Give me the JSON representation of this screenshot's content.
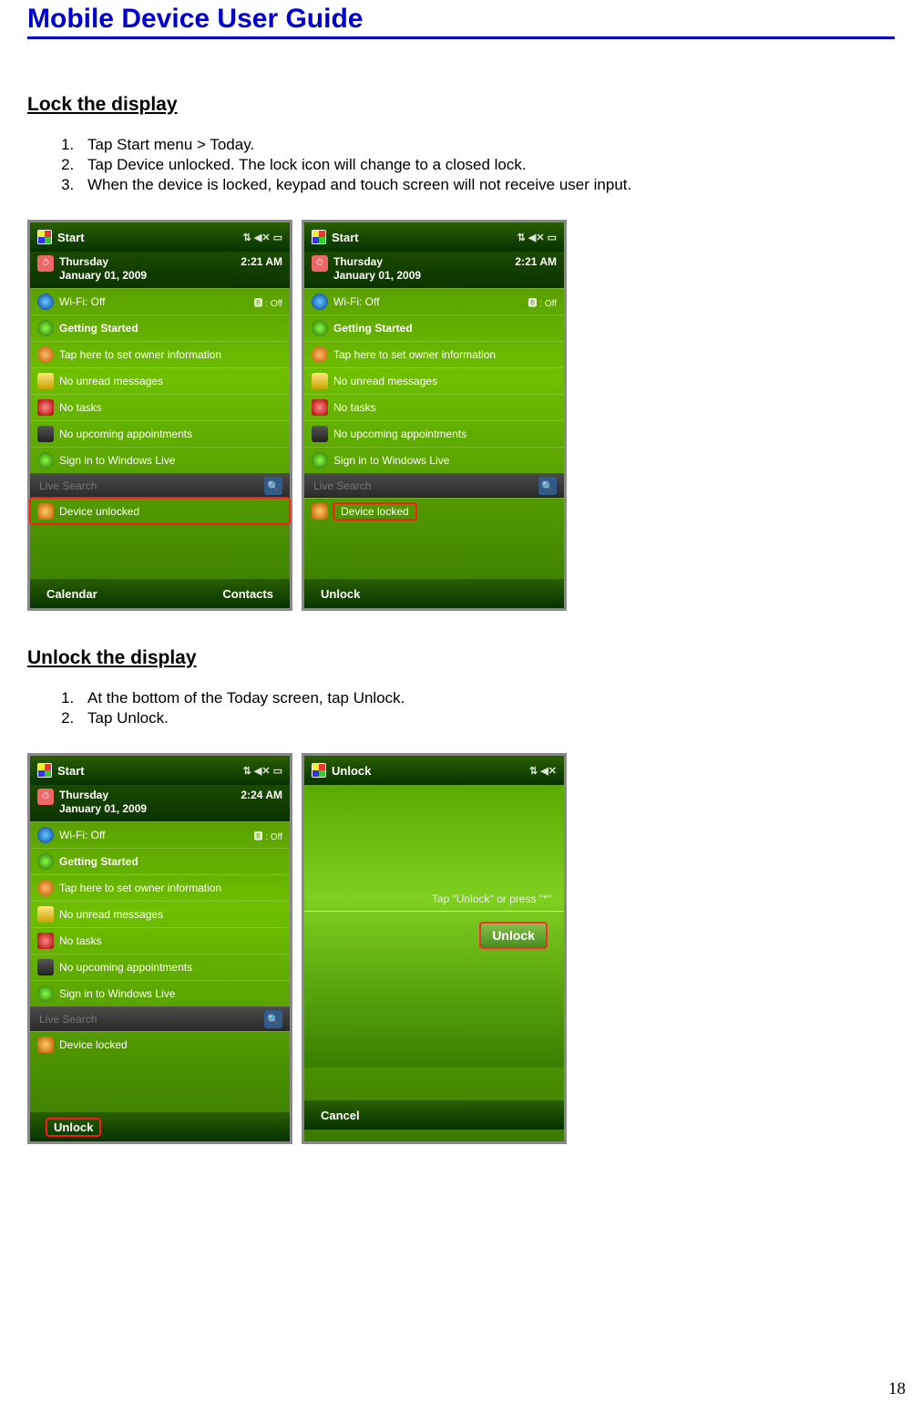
{
  "doc": {
    "title": "Mobile Device User Guide",
    "page_number": "18"
  },
  "sections": {
    "lock": {
      "title": "Lock the display",
      "steps": [
        "Tap Start menu > Today.",
        "Tap Device unlocked. The lock icon will change to a closed lock.",
        "When the device is locked, keypad and touch screen will not receive user input."
      ]
    },
    "unlock": {
      "title": "Unlock the display",
      "steps": [
        "At the bottom of the Today screen, tap Unlock.",
        "Tap Unlock."
      ]
    }
  },
  "wm_common": {
    "start_label": "Start",
    "status_icons": "⇅ ◀✕ ▭",
    "wifi_label": "Wi-Fi: Off",
    "bt_label": "🅱 : Off",
    "getting_started": "Getting Started",
    "owner_info": "Tap here to set owner information",
    "no_messages": "No unread messages",
    "no_tasks": "No tasks",
    "no_appts": "No upcoming appointments",
    "live_signin": "Sign in to Windows Live",
    "live_search_placeholder": "Live Search",
    "search_icon": "🔍"
  },
  "screens": {
    "a": {
      "day": "Thursday",
      "date": "January 01, 2009",
      "time": "2:21 AM",
      "lock_label": "Device unlocked",
      "soft_left": "Calendar",
      "soft_right": "Contacts"
    },
    "b": {
      "day": "Thursday",
      "date": "January 01, 2009",
      "time": "2:21 AM",
      "lock_label": "Device locked",
      "soft_left": "Unlock",
      "soft_right": ""
    },
    "c": {
      "day": "Thursday",
      "date": "January 01, 2009",
      "time": "2:24 AM",
      "lock_label": "Device locked",
      "soft_left": "Unlock",
      "soft_right": ""
    },
    "d": {
      "title": "Unlock",
      "status_icons": "⇅ ◀✕",
      "hint": "Tap \"Unlock\" or press \"*\"",
      "button": "Unlock",
      "soft_left": "Cancel"
    }
  }
}
